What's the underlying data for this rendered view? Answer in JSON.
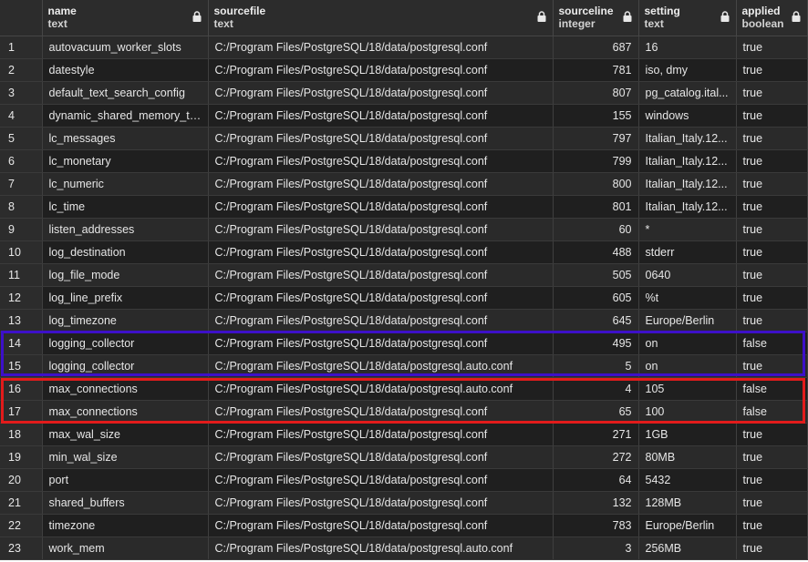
{
  "columns": [
    {
      "title": "name",
      "type": "text"
    },
    {
      "title": "sourcefile",
      "type": "text"
    },
    {
      "title": "sourceline",
      "type": "integer"
    },
    {
      "title": "setting",
      "type": "text"
    },
    {
      "title": "applied",
      "type": "boolean"
    }
  ],
  "rows": [
    {
      "idx": "1",
      "name": "autovacuum_worker_slots",
      "sourcefile": "C:/Program Files/PostgreSQL/18/data/postgresql.conf",
      "sourceline": "687",
      "setting": "16",
      "applied": "true"
    },
    {
      "idx": "2",
      "name": "datestyle",
      "sourcefile": "C:/Program Files/PostgreSQL/18/data/postgresql.conf",
      "sourceline": "781",
      "setting": "iso, dmy",
      "applied": "true"
    },
    {
      "idx": "3",
      "name": "default_text_search_config",
      "sourcefile": "C:/Program Files/PostgreSQL/18/data/postgresql.conf",
      "sourceline": "807",
      "setting": "pg_catalog.ital...",
      "applied": "true"
    },
    {
      "idx": "4",
      "name": "dynamic_shared_memory_ty...",
      "sourcefile": "C:/Program Files/PostgreSQL/18/data/postgresql.conf",
      "sourceline": "155",
      "setting": "windows",
      "applied": "true"
    },
    {
      "idx": "5",
      "name": "lc_messages",
      "sourcefile": "C:/Program Files/PostgreSQL/18/data/postgresql.conf",
      "sourceline": "797",
      "setting": "Italian_Italy.12...",
      "applied": "true"
    },
    {
      "idx": "6",
      "name": "lc_monetary",
      "sourcefile": "C:/Program Files/PostgreSQL/18/data/postgresql.conf",
      "sourceline": "799",
      "setting": "Italian_Italy.12...",
      "applied": "true"
    },
    {
      "idx": "7",
      "name": "lc_numeric",
      "sourcefile": "C:/Program Files/PostgreSQL/18/data/postgresql.conf",
      "sourceline": "800",
      "setting": "Italian_Italy.12...",
      "applied": "true"
    },
    {
      "idx": "8",
      "name": "lc_time",
      "sourcefile": "C:/Program Files/PostgreSQL/18/data/postgresql.conf",
      "sourceline": "801",
      "setting": "Italian_Italy.12...",
      "applied": "true"
    },
    {
      "idx": "9",
      "name": "listen_addresses",
      "sourcefile": "C:/Program Files/PostgreSQL/18/data/postgresql.conf",
      "sourceline": "60",
      "setting": "*",
      "applied": "true"
    },
    {
      "idx": "10",
      "name": "log_destination",
      "sourcefile": "C:/Program Files/PostgreSQL/18/data/postgresql.conf",
      "sourceline": "488",
      "setting": "stderr",
      "applied": "true"
    },
    {
      "idx": "11",
      "name": "log_file_mode",
      "sourcefile": "C:/Program Files/PostgreSQL/18/data/postgresql.conf",
      "sourceline": "505",
      "setting": "0640",
      "applied": "true"
    },
    {
      "idx": "12",
      "name": "log_line_prefix",
      "sourcefile": "C:/Program Files/PostgreSQL/18/data/postgresql.conf",
      "sourceline": "605",
      "setting": "%t",
      "applied": "true"
    },
    {
      "idx": "13",
      "name": "log_timezone",
      "sourcefile": "C:/Program Files/PostgreSQL/18/data/postgresql.conf",
      "sourceline": "645",
      "setting": "Europe/Berlin",
      "applied": "true"
    },
    {
      "idx": "14",
      "name": "logging_collector",
      "sourcefile": "C:/Program Files/PostgreSQL/18/data/postgresql.conf",
      "sourceline": "495",
      "setting": "on",
      "applied": "false"
    },
    {
      "idx": "15",
      "name": "logging_collector",
      "sourcefile": "C:/Program Files/PostgreSQL/18/data/postgresql.auto.conf",
      "sourceline": "5",
      "setting": "on",
      "applied": "true"
    },
    {
      "idx": "16",
      "name": "max_connections",
      "sourcefile": "C:/Program Files/PostgreSQL/18/data/postgresql.auto.conf",
      "sourceline": "4",
      "setting": "105",
      "applied": "false"
    },
    {
      "idx": "17",
      "name": "max_connections",
      "sourcefile": "C:/Program Files/PostgreSQL/18/data/postgresql.conf",
      "sourceline": "65",
      "setting": "100",
      "applied": "false"
    },
    {
      "idx": "18",
      "name": "max_wal_size",
      "sourcefile": "C:/Program Files/PostgreSQL/18/data/postgresql.conf",
      "sourceline": "271",
      "setting": "1GB",
      "applied": "true"
    },
    {
      "idx": "19",
      "name": "min_wal_size",
      "sourcefile": "C:/Program Files/PostgreSQL/18/data/postgresql.conf",
      "sourceline": "272",
      "setting": "80MB",
      "applied": "true"
    },
    {
      "idx": "20",
      "name": "port",
      "sourcefile": "C:/Program Files/PostgreSQL/18/data/postgresql.conf",
      "sourceline": "64",
      "setting": "5432",
      "applied": "true"
    },
    {
      "idx": "21",
      "name": "shared_buffers",
      "sourcefile": "C:/Program Files/PostgreSQL/18/data/postgresql.conf",
      "sourceline": "132",
      "setting": "128MB",
      "applied": "true"
    },
    {
      "idx": "22",
      "name": "timezone",
      "sourcefile": "C:/Program Files/PostgreSQL/18/data/postgresql.conf",
      "sourceline": "783",
      "setting": "Europe/Berlin",
      "applied": "true"
    },
    {
      "idx": "23",
      "name": "work_mem",
      "sourcefile": "C:/Program Files/PostgreSQL/18/data/postgresql.auto.conf",
      "sourceline": "3",
      "setting": "256MB",
      "applied": "true"
    }
  ],
  "icons": {
    "column_header": "lock-icon"
  },
  "colors": {
    "highlight_blue": "#3d10c9",
    "highlight_red": "#e21b1b"
  }
}
